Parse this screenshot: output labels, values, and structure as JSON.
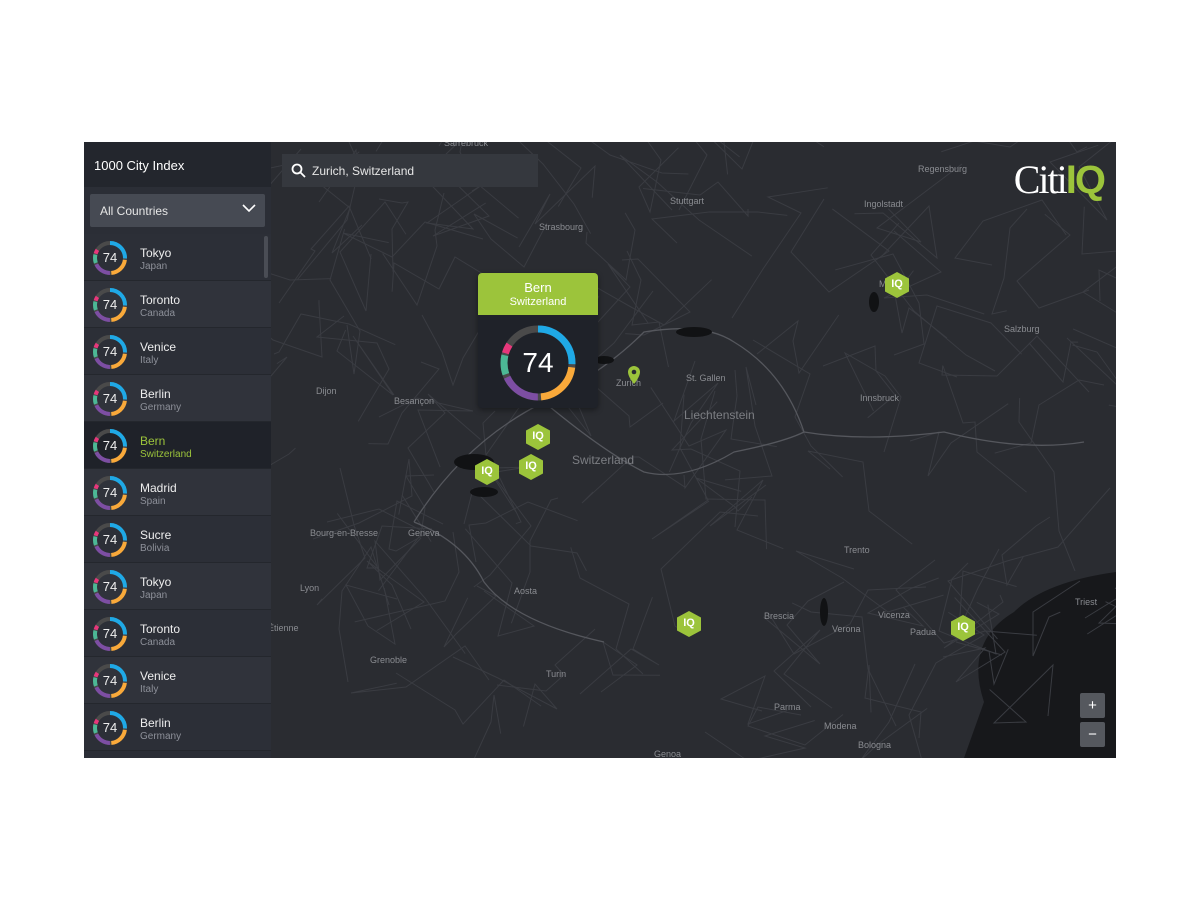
{
  "sidebar": {
    "title": "1000 City Index",
    "filter": "All Countries",
    "items": [
      {
        "city": "Tokyo",
        "country": "Japan",
        "score": "74"
      },
      {
        "city": "Toronto",
        "country": "Canada",
        "score": "74"
      },
      {
        "city": "Venice",
        "country": "Italy",
        "score": "74"
      },
      {
        "city": "Berlin",
        "country": "Germany",
        "score": "74"
      },
      {
        "city": "Bern",
        "country": "Switzerland",
        "score": "74",
        "selected": true
      },
      {
        "city": "Madrid",
        "country": "Spain",
        "score": "74"
      },
      {
        "city": "Sucre",
        "country": "Bolivia",
        "score": "74"
      },
      {
        "city": "Tokyo",
        "country": "Japan",
        "score": "74"
      },
      {
        "city": "Toronto",
        "country": "Canada",
        "score": "74"
      },
      {
        "city": "Venice",
        "country": "Italy",
        "score": "74"
      },
      {
        "city": "Berlin",
        "country": "Germany",
        "score": "74"
      }
    ]
  },
  "search": {
    "value": "Zurich, Switzerland"
  },
  "logo": {
    "text1": "Citi",
    "text2": "IQ"
  },
  "popup": {
    "city": "Bern",
    "country": "Switzerland",
    "score": "74"
  },
  "marker_label": "IQ",
  "zoom": {
    "in": "+",
    "out": "−"
  },
  "map_labels": [
    "Sarrebruck",
    "Stuttgart",
    "Regensburg",
    "Ingolstadt",
    "Strasbourg",
    "Munich",
    "Salzburg",
    "Zurich",
    "St. Gallen",
    "Dijon",
    "Besançon",
    "Liechtenstein",
    "Innsbruck",
    "Switzerland",
    "Bourg-en-Bresse",
    "Geneva",
    "Trento",
    "Lyon",
    "Aosta",
    "Brescia",
    "Triest",
    "Étienne",
    "Verona",
    "Vicenza",
    "Padua",
    "Grenoble",
    "Turin",
    "Parma",
    "Modena",
    "Bologna",
    "Genoa"
  ],
  "colors": {
    "accent": "#9cc43b",
    "blue": "#1fa9e6",
    "orange": "#f9a93a",
    "purple": "#7d4ea3",
    "green": "#4cb895",
    "pink": "#e8377b",
    "track": "#4a4a4a"
  }
}
